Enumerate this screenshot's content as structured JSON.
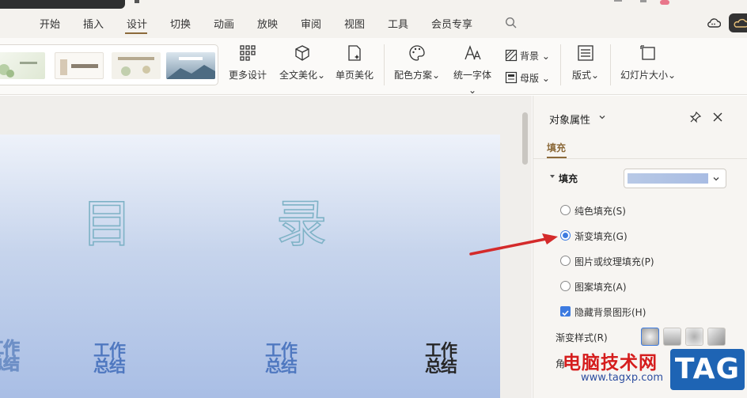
{
  "menu": {
    "tabs": [
      {
        "label": "开始"
      },
      {
        "label": "插入"
      },
      {
        "label": "设计"
      },
      {
        "label": "切换"
      },
      {
        "label": "动画"
      },
      {
        "label": "放映"
      },
      {
        "label": "审阅"
      },
      {
        "label": "视图"
      },
      {
        "label": "工具"
      },
      {
        "label": "会员专享"
      }
    ],
    "active_tab": "设计"
  },
  "ribbon": {
    "more_design": "更多设计",
    "full_beautify": "全文美化",
    "page_beautify": "单页美化",
    "color_scheme": "配色方案",
    "unify_font": "统一字体",
    "background": "背景",
    "master": "母版",
    "layout": "版式",
    "slide_size": "幻灯片大小"
  },
  "slide": {
    "char_1": "目",
    "char_2": "录",
    "items": [
      {
        "line1": "工作",
        "line2": "总结"
      },
      {
        "line1": "工作",
        "line2": "总结"
      },
      {
        "line1": "工作",
        "line2": "总结"
      },
      {
        "line1": "工作",
        "line2": "总结"
      }
    ]
  },
  "panel": {
    "title": "对象属性",
    "tab_fill": "填充",
    "section_fill": "填充",
    "options": [
      {
        "label": "纯色填充(S)",
        "checked": false
      },
      {
        "label": "渐变填充(G)",
        "checked": true
      },
      {
        "label": "图片或纹理填充(P)",
        "checked": false
      },
      {
        "label": "图案填充(A)",
        "checked": false
      }
    ],
    "hide_bg_label": "隐藏背景图形(H)",
    "hide_bg_checked": true,
    "gradient_style_label": "渐变样式(R)",
    "angle_label": "角"
  },
  "watermark": {
    "text": "电脑技术网",
    "url": "www.tagxp.com",
    "logo": "TAG"
  },
  "colors": {
    "accent": "#8c6a3a",
    "selected": "#3d7be0",
    "arrow": "#d42a2a"
  }
}
